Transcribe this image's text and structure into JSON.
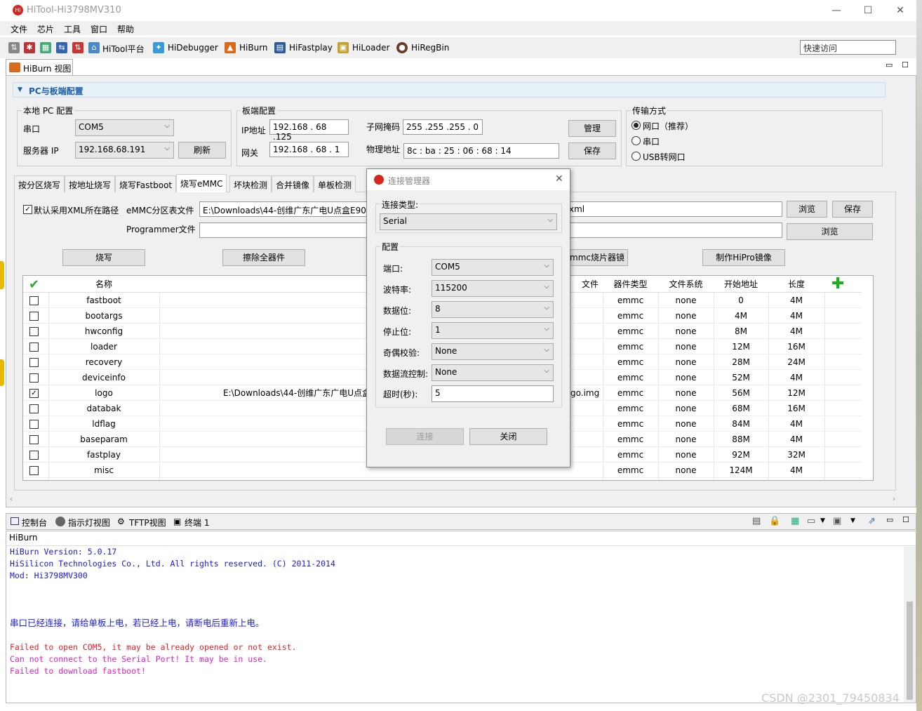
{
  "window": {
    "title": "HiTool-Hi3798MV310",
    "min": "—",
    "max": "☐",
    "close": "✕"
  },
  "menu": [
    "文件",
    "芯片",
    "工具",
    "窗口",
    "帮助"
  ],
  "toolbar": {
    "items": [
      {
        "label": "HiTool平台",
        "icon": "home-icon"
      },
      {
        "label": "HiDebugger",
        "icon": "debugger-icon"
      },
      {
        "label": "HiBurn",
        "icon": "burn-icon"
      },
      {
        "label": "HiFastplay",
        "icon": "fastplay-icon"
      },
      {
        "label": "HiLoader",
        "icon": "loader-icon"
      },
      {
        "label": "HiRegBin",
        "icon": "regbin-icon"
      }
    ],
    "quick_access_placeholder": "快速访问"
  },
  "view_tab": "HiBurn 视图",
  "section_title": "PC与板端配置",
  "local_pc": {
    "title": "本地 PC 配置",
    "serial_label": "串口",
    "serial_value": "COM5",
    "server_ip_label": "服务器 IP",
    "server_ip_value": "192.168.68.191",
    "refresh": "刷新"
  },
  "board": {
    "title": "板端配置",
    "ip_label": "IP地址",
    "ip_value": "192.168 . 68 .125",
    "gateway_label": "网关",
    "gateway_value": "192.168 . 68 . 1",
    "mask_label": "子网掩码",
    "mask_value": "255 .255 .255 . 0",
    "mac_label": "物理地址",
    "mac_value": "8c  :  ba  :  25  :  06  :  68  :  14",
    "manage": "管理",
    "save": "保存"
  },
  "transfer": {
    "title": "传输方式",
    "options": [
      "网口（推荐）",
      "串口",
      "USB转网口"
    ],
    "selected": 0
  },
  "tabs": [
    "按分区烧写",
    "按地址烧写",
    "烧写Fastboot",
    "烧写eMMC",
    "坏块检测",
    "合并镜像",
    "单板检测"
  ],
  "active_tab": 3,
  "emmc": {
    "xml_default_label": "默认采用XML所在路径",
    "partition_file_label": "eMMC分区表文件",
    "partition_file_value": "E:\\Downloads\\44-创维广东广电U点盒E900",
    "partition_file_tail": "xml",
    "programmer_label": "Programmer文件",
    "programmer_value": "",
    "browse": "浏览",
    "save": "保存",
    "burn": "烧写",
    "erase_all": "擦除全器件",
    "emmc_image": "mmc烧片器镜像",
    "hipro_image": "制作HiPro镜像"
  },
  "table": {
    "headers": {
      "name": "名称",
      "file": "文件",
      "device_type": "器件类型",
      "fs": "文件系统",
      "start": "开始地址",
      "length": "长度"
    },
    "rows": [
      {
        "checked": false,
        "name": "fastboot",
        "file": "",
        "type": "emmc",
        "fs": "none",
        "start": "0",
        "len": "4M"
      },
      {
        "checked": false,
        "name": "bootargs",
        "file": "",
        "type": "emmc",
        "fs": "none",
        "start": "4M",
        "len": "4M"
      },
      {
        "checked": false,
        "name": "hwconfig",
        "file": "",
        "type": "emmc",
        "fs": "none",
        "start": "8M",
        "len": "4M"
      },
      {
        "checked": false,
        "name": "loader",
        "file": "",
        "type": "emmc",
        "fs": "none",
        "start": "12M",
        "len": "16M"
      },
      {
        "checked": false,
        "name": "recovery",
        "file": "",
        "type": "emmc",
        "fs": "none",
        "start": "28M",
        "len": "24M"
      },
      {
        "checked": false,
        "name": "deviceinfo",
        "file": "",
        "type": "emmc",
        "fs": "none",
        "start": "52M",
        "len": "4M"
      },
      {
        "checked": true,
        "name": "logo",
        "file": "E:\\Downloads\\44-创维广东广电U点盒",
        "file_tail": "go.img",
        "type": "emmc",
        "fs": "none",
        "start": "56M",
        "len": "12M"
      },
      {
        "checked": false,
        "name": "databak",
        "file": "",
        "type": "emmc",
        "fs": "none",
        "start": "68M",
        "len": "16M"
      },
      {
        "checked": false,
        "name": "ldflag",
        "file": "",
        "type": "emmc",
        "fs": "none",
        "start": "84M",
        "len": "4M"
      },
      {
        "checked": false,
        "name": "baseparam",
        "file": "",
        "type": "emmc",
        "fs": "none",
        "start": "88M",
        "len": "4M"
      },
      {
        "checked": false,
        "name": "fastplay",
        "file": "",
        "type": "emmc",
        "fs": "none",
        "start": "92M",
        "len": "32M"
      },
      {
        "checked": false,
        "name": "misc",
        "file": "",
        "type": "emmc",
        "fs": "none",
        "start": "124M",
        "len": "4M"
      }
    ]
  },
  "console_tabs": [
    "控制台",
    "指示灯视图",
    "TFTP视图",
    "终端 1"
  ],
  "console": {
    "caption": "HiBurn",
    "lines": [
      {
        "text": "HiBurn Version: 5.0.17",
        "color": "#1a1ad6"
      },
      {
        "text": "HiSilicon Technologies Co., Ltd. All rights reserved. (C) 2011-2014",
        "color": "#1a1ad6"
      },
      {
        "text": "Mod: Hi3798MV300",
        "color": "#1a1ad6"
      },
      {
        "text": "串口已经连接，请给单板上电，若已经上电，请断电后重新上电。",
        "color": "#1a1ad6"
      },
      {
        "text": "Failed to open COM5, it may be already opened or not exist.",
        "color": "#e8202a"
      },
      {
        "text": "Can not connect to the Serial Port! It may be in use.",
        "color": "#e020c8"
      },
      {
        "text": "Failed to download fastboot!",
        "color": "#e020c8"
      }
    ]
  },
  "dialog": {
    "title": "连接管理器",
    "conn_type_label": "连接类型:",
    "conn_type": "Serial",
    "config_label": "配置",
    "fields": [
      {
        "label": "端口:",
        "value": "COM5"
      },
      {
        "label": "波特率:",
        "value": "115200"
      },
      {
        "label": "数据位:",
        "value": "8"
      },
      {
        "label": "停止位:",
        "value": "1"
      },
      {
        "label": "奇偶校验:",
        "value": "None"
      },
      {
        "label": "数据流控制:",
        "value": "None"
      }
    ],
    "timeout_label": "超时(秒):",
    "timeout_value": "5",
    "connect": "连接",
    "close": "关闭"
  },
  "watermark": "CSDN @2301_79450834"
}
